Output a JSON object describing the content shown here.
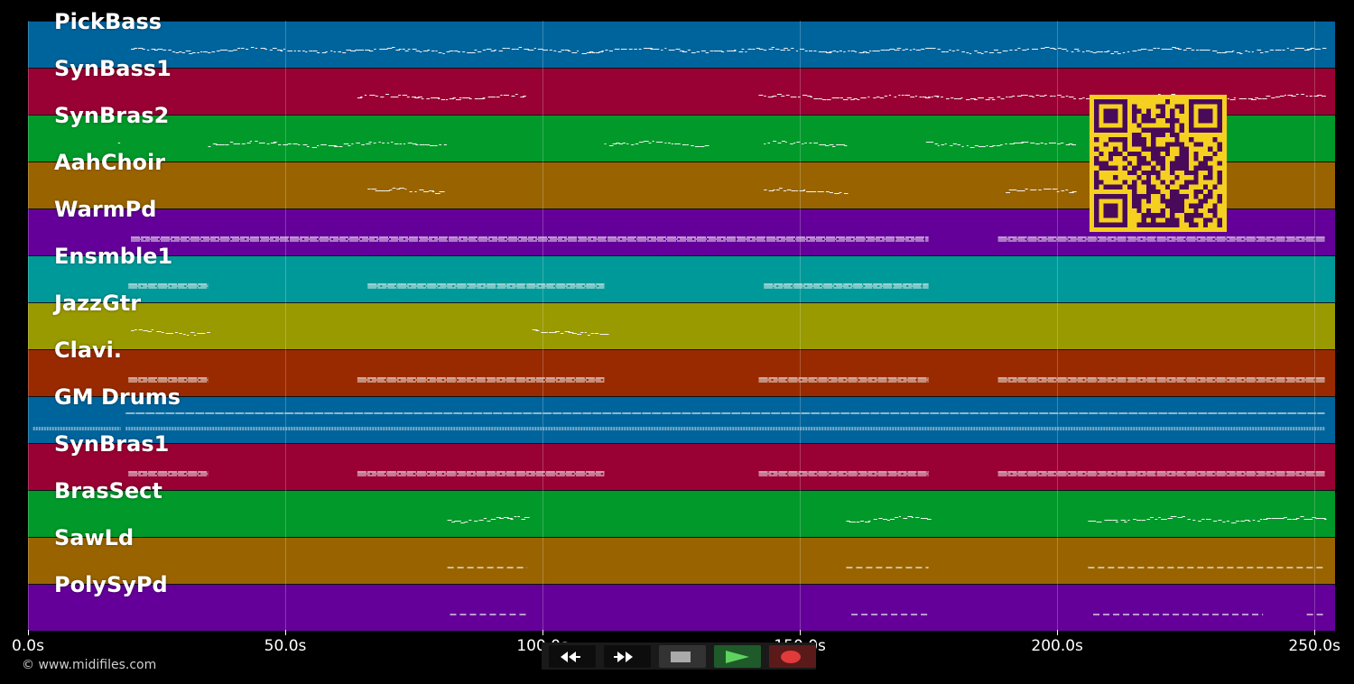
{
  "tracks": [
    {
      "name": "PickBass",
      "color": "#00649c",
      "style": "dots",
      "segments": [
        [
          20,
          252
        ]
      ]
    },
    {
      "name": "SynBass1",
      "color": "#990033",
      "style": "dots",
      "segments": [
        [
          64,
          97
        ],
        [
          142,
          252
        ]
      ]
    },
    {
      "name": "SynBras2",
      "color": "#00992a",
      "style": "dots",
      "segments": [
        [
          17.5,
          18.5
        ],
        [
          35,
          81
        ],
        [
          112,
          132
        ],
        [
          143,
          159
        ],
        [
          174.5,
          203
        ]
      ]
    },
    {
      "name": "AahChoir",
      "color": "#996400",
      "style": "dots",
      "segments": [
        [
          66,
          81
        ],
        [
          143,
          159
        ],
        [
          190,
          203
        ]
      ]
    },
    {
      "name": "WarmPd",
      "color": "#640099",
      "style": "lines",
      "segments": [
        [
          20,
          175
        ],
        [
          188.5,
          252
        ]
      ]
    },
    {
      "name": "Ensmble1",
      "color": "#009999",
      "style": "lines",
      "segments": [
        [
          19.5,
          35
        ],
        [
          66,
          112
        ],
        [
          143,
          175
        ]
      ]
    },
    {
      "name": "JazzGtr",
      "color": "#999900",
      "style": "dots",
      "segments": [
        [
          20,
          35
        ],
        [
          98,
          112
        ]
      ]
    },
    {
      "name": "Clavi.",
      "color": "#992a00",
      "style": "lines",
      "segments": [
        [
          19.5,
          35
        ],
        [
          64,
          112
        ],
        [
          142,
          175
        ],
        [
          188.5,
          252
        ]
      ]
    },
    {
      "name": "GM Drums",
      "color": "#00649c",
      "style": "drums",
      "segments": [
        [
          1,
          18
        ],
        [
          19,
          252
        ]
      ]
    },
    {
      "name": "SynBras1",
      "color": "#990033",
      "style": "lines",
      "segments": [
        [
          19.5,
          35
        ],
        [
          64,
          112
        ],
        [
          142,
          175
        ],
        [
          188.5,
          252
        ]
      ]
    },
    {
      "name": "BrasSect",
      "color": "#00992a",
      "style": "dots",
      "segments": [
        [
          81.5,
          97
        ],
        [
          159,
          175
        ],
        [
          206,
          252
        ]
      ]
    },
    {
      "name": "SawLd",
      "color": "#996400",
      "style": "dashes",
      "segments": [
        [
          81.5,
          97
        ],
        [
          159,
          175
        ],
        [
          206,
          252
        ]
      ]
    },
    {
      "name": "PolySyPd",
      "color": "#640099",
      "style": "dashes",
      "segments": [
        [
          82,
          97
        ],
        [
          160,
          175
        ],
        [
          207,
          240
        ],
        [
          248.5,
          252
        ]
      ]
    }
  ],
  "timeline": {
    "min_seconds": 0,
    "max_seconds": 254,
    "ticks": [
      {
        "value": 0,
        "label": "0.0s"
      },
      {
        "value": 50,
        "label": "50.0s"
      },
      {
        "value": 100,
        "label": "100.0s"
      },
      {
        "value": 150,
        "label": "150.0s"
      },
      {
        "value": 200,
        "label": "200.0s"
      },
      {
        "value": 250,
        "label": "250.0s"
      }
    ]
  },
  "copyright": "© www.midifiles.com",
  "transport": {
    "buttons": [
      {
        "name": "rewind-button",
        "icon": "rewind-icon",
        "bg": "#0d0d0d"
      },
      {
        "name": "fast-forward-button",
        "icon": "fast-forward-icon",
        "bg": "#0d0d0d"
      },
      {
        "name": "stop-button",
        "icon": "stop-icon",
        "bg": "#333333"
      },
      {
        "name": "play-button",
        "icon": "play-icon",
        "bg": "#1f5a2a"
      },
      {
        "name": "record-button",
        "icon": "record-icon",
        "bg": "#5a1a1a"
      }
    ]
  },
  "qr": {
    "fg": "#4a0a5a",
    "bg": "#f5d020"
  }
}
